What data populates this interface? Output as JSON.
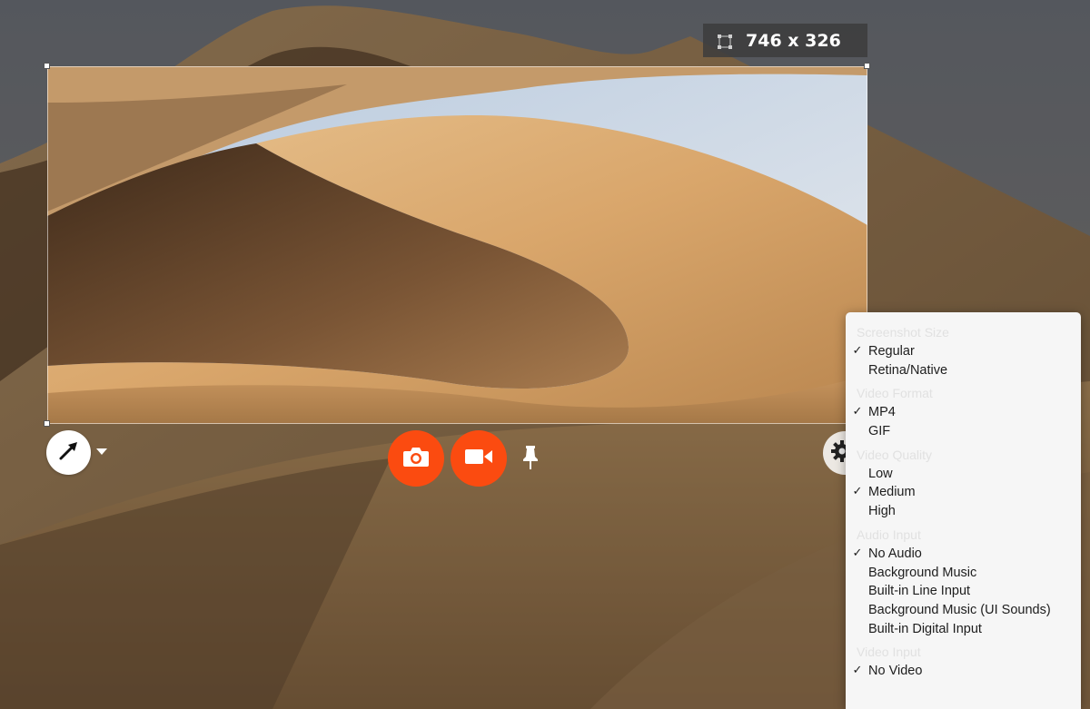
{
  "selection": {
    "dimensions_label": "746 x 326"
  },
  "toolbar": {
    "annotate_tool": "arrow-icon",
    "screenshot_button": "camera-icon",
    "record_button": "video-camera-icon",
    "pin_button": "pin-icon",
    "settings_button": "gear-icon"
  },
  "colors": {
    "accent": "#fb4b10",
    "menu_bg": "#f6f6f6",
    "badge_bg": "#3c3c3c"
  },
  "menu": {
    "sections": [
      {
        "header": "Screenshot Size",
        "items": [
          {
            "label": "Regular",
            "checked": true
          },
          {
            "label": "Retina/Native",
            "checked": false
          }
        ]
      },
      {
        "header": "Video Format",
        "items": [
          {
            "label": "MP4",
            "checked": true
          },
          {
            "label": "GIF",
            "checked": false
          }
        ]
      },
      {
        "header": "Video Quality",
        "items": [
          {
            "label": "Low",
            "checked": false
          },
          {
            "label": "Medium",
            "checked": true
          },
          {
            "label": "High",
            "checked": false
          }
        ]
      },
      {
        "header": "Audio Input",
        "items": [
          {
            "label": "No Audio",
            "checked": true
          },
          {
            "label": "Background Music",
            "checked": false
          },
          {
            "label": "Built-in Line Input",
            "checked": false
          },
          {
            "label": "Background Music (UI Sounds)",
            "checked": false
          },
          {
            "label": "Built-in Digital Input",
            "checked": false
          }
        ]
      },
      {
        "header": "Video Input",
        "items": [
          {
            "label": "No Video",
            "checked": true
          }
        ]
      }
    ],
    "check_glyph": "✓"
  }
}
